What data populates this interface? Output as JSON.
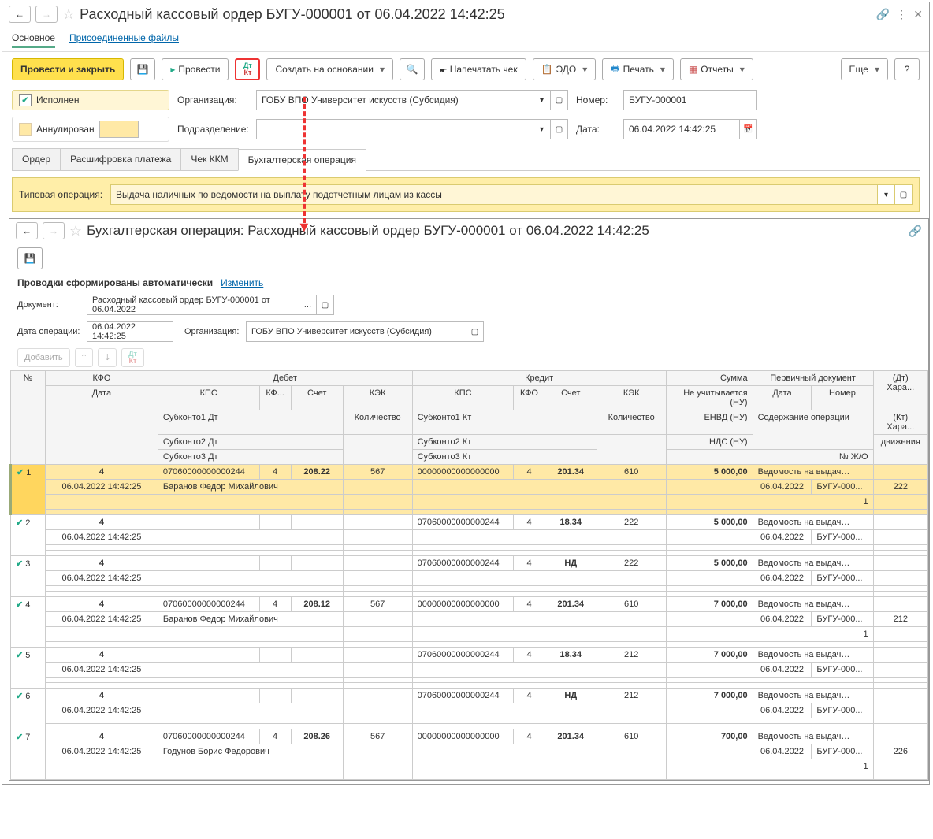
{
  "top": {
    "title": "Расходный кассовый ордер БУГУ-000001 от 06.04.2022 14:42:25",
    "linktabs": [
      "Основное",
      "Присоединенные файлы"
    ],
    "toolbar": {
      "post_close": "Провести и закрыть",
      "post": "Провести",
      "create_based": "Создать на основании",
      "print_check": "Напечатать чек",
      "edo": "ЭДО",
      "print": "Печать",
      "reports": "Отчеты",
      "more": "Еще"
    },
    "checks": {
      "executed": "Исполнен",
      "annulled": "Аннулирован"
    },
    "fields": {
      "org_label": "Организация:",
      "org_value": "ГОБУ ВПО Университет искусств (Субсидия)",
      "num_label": "Номер:",
      "num_value": "БУГУ-000001",
      "dept_label": "Подразделение:",
      "dept_value": "",
      "date_label": "Дата:",
      "date_value": "06.04.2022 14:42:25"
    },
    "tabs": [
      "Ордер",
      "Расшифровка платежа",
      "Чек ККМ",
      "Бухгалтерская операция"
    ],
    "typ_label": "Типовая операция:",
    "typ_value": "Выдача наличных по ведомости на выплату подотчетным лицам из кассы"
  },
  "sub": {
    "title": "Бухгалтерская операция: Расходный кассовый ордер БУГУ-000001 от 06.04.2022 14:42:25",
    "auto_label": "Проводки сформированы автоматически",
    "change_link": "Изменить",
    "fields": {
      "doc_label": "Документ:",
      "doc_value": "Расходный кассовый ордер БУГУ-000001 от 06.04.2022",
      "opdate_label": "Дата операции:",
      "opdate_value": "06.04.2022 14:42:25",
      "org_label": "Организация:",
      "org_value": "ГОБУ ВПО Университет искусств (Субсидия)"
    },
    "btns": {
      "add": "Добавить"
    },
    "headers": {
      "n": "№",
      "kfo": "КФО",
      "date": "Дата",
      "debit": "Дебет",
      "credit": "Кредит",
      "kps": "КПС",
      "kf": "КФ...",
      "acct": "Счет",
      "kek": "КЭК",
      "sub1d": "Субконто1 Дт",
      "sub2d": "Субконто2 Дт",
      "sub3d": "Субконто3 Дт",
      "sub1k": "Субконто1 Кт",
      "sub2k": "Субконто2 Кт",
      "sub3k": "Субконто3 Кт",
      "qty": "Количество",
      "sum": "Сумма",
      "nu": "Не учитывается (НУ)",
      "envd": "ЕНВД (НУ)",
      "nds": "НДС (НУ)",
      "primdoc": "Первичный документ",
      "docdate": "Дата",
      "docnum": "Номер",
      "content": "Содержание операции",
      "jo": "№ Ж/О",
      "dthar": "(Дт) Хара...",
      "kthar": "(Кт) Хара...",
      "move": "движения"
    },
    "rows": [
      {
        "n": "1",
        "kfo": "4",
        "date": "06.04.2022 14:42:25",
        "dkps": "07060000000000244",
        "dkf": "4",
        "dacct": "208.22",
        "dkek": "567",
        "dsub": "Баранов Федор Михайлович",
        "ckps": "00000000000000000",
        "ckf": "4",
        "cacct": "201.34",
        "ckek": "610",
        "sum": "5 000,00",
        "doc": "Ведомость на выдачу де...",
        "docdate": "06.04.2022",
        "docnum": "БУГУ-000...",
        "jo": "222",
        "extra": "1"
      },
      {
        "n": "2",
        "kfo": "4",
        "date": "06.04.2022 14:42:25",
        "dkps": "",
        "dkf": "",
        "dacct": "",
        "dkek": "",
        "dsub": "",
        "ckps": "07060000000000244",
        "ckf": "4",
        "cacct": "18.34",
        "ckek": "222",
        "sum": "5 000,00",
        "doc": "Ведомость на выдачу де...",
        "docdate": "06.04.2022",
        "docnum": "БУГУ-000...",
        "jo": "",
        "extra": ""
      },
      {
        "n": "3",
        "kfo": "4",
        "date": "06.04.2022 14:42:25",
        "dkps": "",
        "dkf": "",
        "dacct": "",
        "dkek": "",
        "dsub": "",
        "ckps": "07060000000000244",
        "ckf": "4",
        "cacct": "НД",
        "ckek": "222",
        "sum": "5 000,00",
        "doc": "Ведомость на выдачу де...",
        "docdate": "06.04.2022",
        "docnum": "БУГУ-000...",
        "jo": "",
        "extra": ""
      },
      {
        "n": "4",
        "kfo": "4",
        "date": "06.04.2022 14:42:25",
        "dkps": "07060000000000244",
        "dkf": "4",
        "dacct": "208.12",
        "dkek": "567",
        "dsub": "Баранов Федор Михайлович",
        "ckps": "00000000000000000",
        "ckf": "4",
        "cacct": "201.34",
        "ckek": "610",
        "sum": "7 000,00",
        "doc": "Ведомость на выдачу де...",
        "docdate": "06.04.2022",
        "docnum": "БУГУ-000...",
        "jo": "212",
        "extra": "1"
      },
      {
        "n": "5",
        "kfo": "4",
        "date": "06.04.2022 14:42:25",
        "dkps": "",
        "dkf": "",
        "dacct": "",
        "dkek": "",
        "dsub": "",
        "ckps": "07060000000000244",
        "ckf": "4",
        "cacct": "18.34",
        "ckek": "212",
        "sum": "7 000,00",
        "doc": "Ведомость на выдачу де...",
        "docdate": "06.04.2022",
        "docnum": "БУГУ-000...",
        "jo": "",
        "extra": ""
      },
      {
        "n": "6",
        "kfo": "4",
        "date": "06.04.2022 14:42:25",
        "dkps": "",
        "dkf": "",
        "dacct": "",
        "dkek": "",
        "dsub": "",
        "ckps": "07060000000000244",
        "ckf": "4",
        "cacct": "НД",
        "ckek": "212",
        "sum": "7 000,00",
        "doc": "Ведомость на выдачу де...",
        "docdate": "06.04.2022",
        "docnum": "БУГУ-000...",
        "jo": "",
        "extra": ""
      },
      {
        "n": "7",
        "kfo": "4",
        "date": "06.04.2022 14:42:25",
        "dkps": "07060000000000244",
        "dkf": "4",
        "dacct": "208.26",
        "dkek": "567",
        "dsub": "Годунов Борис Федорович",
        "ckps": "00000000000000000",
        "ckf": "4",
        "cacct": "201.34",
        "ckek": "610",
        "sum": "700,00",
        "doc": "Ведомость на выдачу де...",
        "docdate": "06.04.2022",
        "docnum": "БУГУ-000...",
        "jo": "226",
        "extra": "1"
      }
    ]
  }
}
